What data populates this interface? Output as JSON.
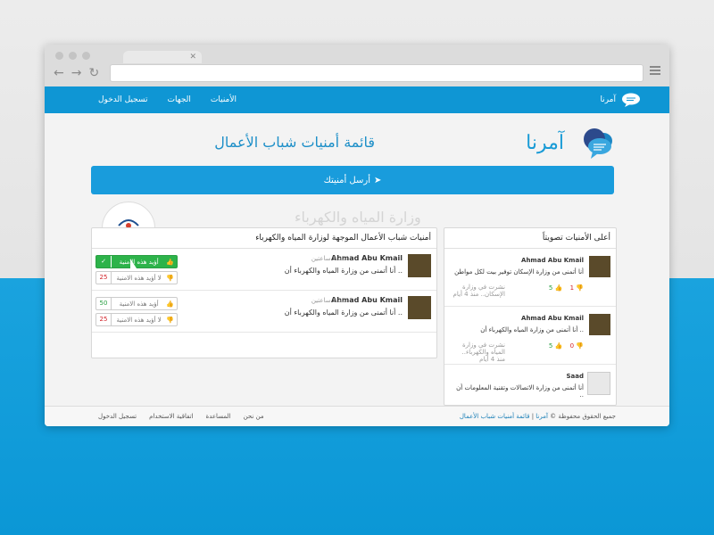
{
  "nav": {
    "brand_small": "آمرنا",
    "links": [
      "تسجيل الدخول",
      "الجهات",
      "الأمنيات"
    ]
  },
  "header": {
    "brand": "آمرنا",
    "title": "قائمة أمنيات شباب الأعمال",
    "send_button": "أرسل أمنيتك",
    "org_name": "وزارة المياه والكهرباء"
  },
  "main": {
    "title": "أمنيات شباب الأعمال الموجهة لوزارة المياه والكهرباء",
    "items": [
      {
        "name": "Ahmad Abu Kmail",
        "time": "منذ 2 ساعتين",
        "text": "أنا أتمنى من وزارة المياه والكهرباء أن ..",
        "up_count": "",
        "up_label": "أؤيد هذه الامنية",
        "down_count": "25",
        "down_label": "لا أؤيد هذه الامنية"
      },
      {
        "name": "Ahmad Abu Kmail",
        "time": "منذ 2 ساعتين",
        "text": "أنا أتمنى من وزارة المياه والكهرباء أن ..",
        "up_count": "50",
        "up_label": "أؤيد هذه الامنية",
        "down_count": "25",
        "down_label": "لا أؤيد هذه الامنية"
      }
    ]
  },
  "side": {
    "title": "أعلى الأمنيات تصويتاً",
    "items": [
      {
        "name": "Ahmad Abu Kmail",
        "text": "أنا أتمنى من وزارة الإسكان توفير بيت لكل مواطن",
        "likes": "5",
        "dislikes": "1",
        "meta": "نشرت في وزارة الإسكان.. منذ 4 أيام"
      },
      {
        "name": "Ahmad Abu Kmail",
        "text": "أنا أتمنى من وزارة المياه والكهرباء أن ..",
        "likes": "5",
        "dislikes": "0",
        "meta": "نشرت في وزارة المياه والكهرباء.. منذ 4 أيام"
      },
      {
        "name": "Saad",
        "text": "أنا أتمنى من وزارة الاتصالات وتقنية المعلومات أن ..",
        "likes": "",
        "dislikes": "",
        "meta": ""
      }
    ]
  },
  "footer": {
    "copyright": "جميع الحقوق محفوظة ©",
    "brand_link": "آمرنا",
    "list_link": "قائمة أمنيات شباب الأعمال",
    "links": [
      "من نحن",
      "المساعدة",
      "اتفاقية الاستخدام",
      "تسجيل الدخول"
    ]
  },
  "colors": {
    "accent": "#0f96d4",
    "up": "#2db34a",
    "down": "#d2232a"
  }
}
